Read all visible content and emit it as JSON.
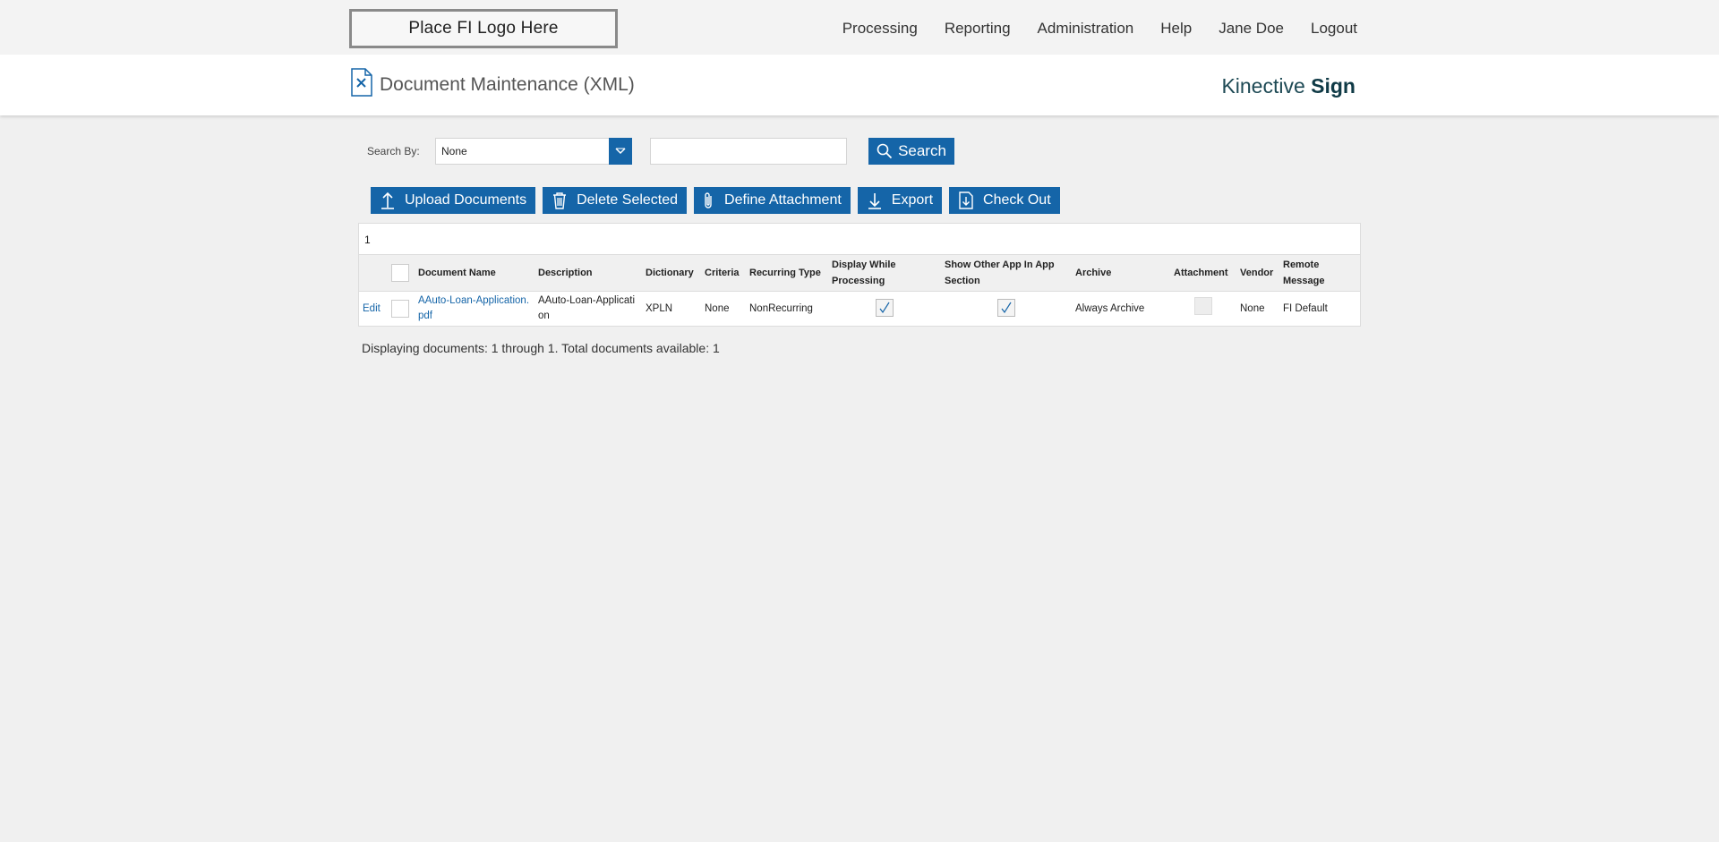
{
  "header": {
    "logo_text": "Place FI Logo Here",
    "nav": [
      "Processing",
      "Reporting",
      "Administration",
      "Help",
      "Jane Doe",
      "Logout"
    ]
  },
  "titlebar": {
    "title": "Document Maintenance (XML)",
    "brand_light": "Kinective",
    "brand_bold": "Sign"
  },
  "search": {
    "label": "Search By:",
    "select_value": "None",
    "input_value": "",
    "button_label": "Search"
  },
  "actions": {
    "upload": "Upload Documents",
    "delete": "Delete Selected",
    "define": "Define Attachment",
    "export": "Export",
    "checkout": "Check Out"
  },
  "grid": {
    "page": "1",
    "columns": {
      "name": "Document Name",
      "description": "Description",
      "dictionary": "Dictionary",
      "criteria": "Criteria",
      "recurring": "Recurring Type",
      "display_while": "Display While Processing",
      "show_other": "Show Other App In App Section",
      "archive": "Archive",
      "attachment": "Attachment",
      "vendor": "Vendor",
      "remote": "Remote Message"
    },
    "rows": [
      {
        "edit": "Edit",
        "name": "AAuto-Loan-Application.pdf",
        "description": "AAuto-Loan-Application",
        "dictionary": "XPLN",
        "criteria": "None",
        "recurring": "NonRecurring",
        "display_while": true,
        "show_other": true,
        "archive": "Always Archive",
        "attachment": false,
        "vendor": "None",
        "remote": "FI Default"
      }
    ]
  },
  "footer": {
    "status": "Displaying documents: 1 through 1. Total documents available: 1"
  },
  "colors": {
    "primary": "#1565a8",
    "brand": "#0f3a46"
  }
}
